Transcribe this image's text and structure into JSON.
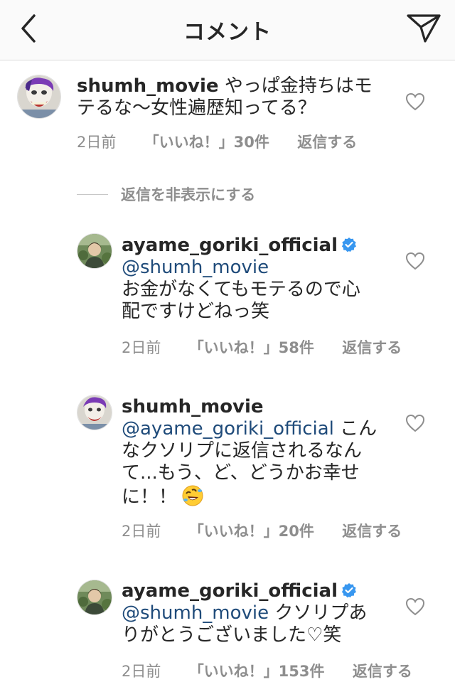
{
  "header": {
    "title": "コメント",
    "back_icon": "chevron-left-icon",
    "share_icon": "paper-plane-icon"
  },
  "colors": {
    "text": "#262626",
    "meta": "#8e8e8e",
    "mention": "#1f4b7a",
    "verified": "#3897f0",
    "header_bg": "#fafafa"
  },
  "hide_replies_label": "返信を非表示にする",
  "comments": [
    {
      "username": "shumh_movie",
      "mention": "",
      "text": "やっぱ金持ちはモ",
      "text2": "テるな〜女性遍歴知ってる？",
      "time": "2日前",
      "likes": "「いいね！」30件",
      "reply": "返信する"
    },
    {
      "username": "ayame_goriki_official",
      "verified": true,
      "mention": "@shumh_movie",
      "text": "お金がなくてもモテるので心",
      "text2": "配ですけどねっ笑",
      "time": "2日前",
      "likes": "「いいね！」58件",
      "reply": "返信する"
    },
    {
      "username": "shumh_movie",
      "mention": "@ayame_goriki_official",
      "text_after_mention": "こん",
      "text": "なクソリプに返信されるなん",
      "text2": "て...もう、ど、どうかお幸せ",
      "text3": "に！！",
      "emoji": "rolling-on-floor-laughing-emoji",
      "time": "2日前",
      "likes": "「いいね！」20件",
      "reply": "返信する"
    },
    {
      "username": "ayame_goriki_official",
      "verified": true,
      "mention": "@shumh_movie",
      "text_after_mention": "クソリプあ",
      "text": "りがとうございました♡笑",
      "time": "2日前",
      "likes": "「いいね！」153件",
      "reply": "返信する"
    }
  ]
}
